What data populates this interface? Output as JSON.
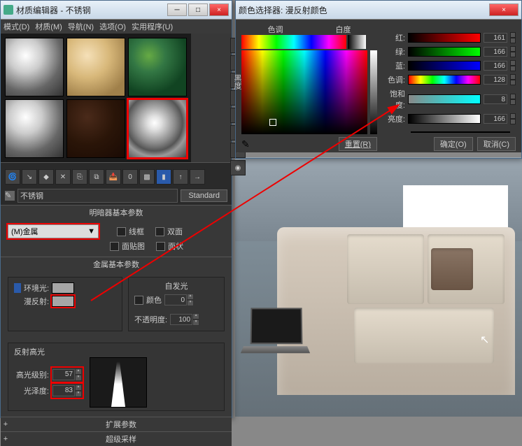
{
  "matEditor": {
    "title": "材质编辑器 - 不锈钢",
    "menus": [
      "模式(D)",
      "材质(M)",
      "导航(N)",
      "选项(O)",
      "实用程序(U)"
    ],
    "name": "不锈钢",
    "typeBtn": "Standard",
    "shader": {
      "title": "明暗器基本参数",
      "value": "(M)金属",
      "wire": "线框",
      "twoSided": "双面",
      "faceMap": "面贴图",
      "faceted": "面状"
    },
    "metal": {
      "title": "金属基本参数",
      "ambient": "环境光:",
      "diffuse": "漫反射:",
      "selfIllum": "自发光",
      "color": "颜色",
      "opacity": "不透明度:",
      "selfVal": "0",
      "opVal": "100"
    },
    "spec": {
      "title": "反射高光",
      "level": "高光级别:",
      "gloss": "光泽度:",
      "levelVal": "57",
      "glossVal": "83"
    },
    "ext1": "扩展参数",
    "ext2": "超级采样"
  },
  "colorPicker": {
    "title": "颜色选择器: 漫反射颜色",
    "hue": "色调",
    "whiteness": "白度",
    "blackness": "黑度",
    "ch": {
      "r": "红:",
      "g": "绿:",
      "b": "蓝:",
      "h": "色调:",
      "s": "饱和度:",
      "v": "亮度:"
    },
    "vals": {
      "r": "161",
      "g": "166",
      "b": "166",
      "h": "128",
      "s": "8",
      "v": "166"
    },
    "reset": "重置(R)",
    "ok": "确定(O)",
    "cancel": "取消(C)"
  }
}
